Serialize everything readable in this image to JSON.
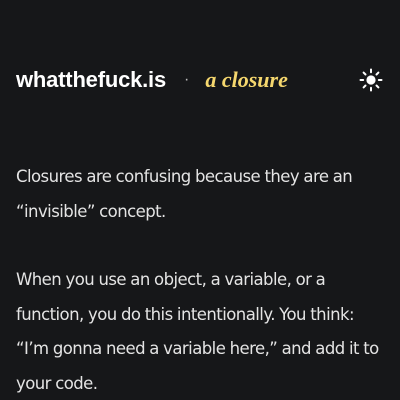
{
  "header": {
    "site_name": "whatthefuck.is",
    "separator": "·",
    "topic": "a closure",
    "theme_toggle_icon": "sun-icon"
  },
  "article": {
    "paragraphs": [
      "Closures are confusing because they are an “invisible” concept.",
      "When you use an object, a variable, or a function, you do this intentionally. You think: “I’m gonna need a variable here,” and add it to your code."
    ]
  },
  "colors": {
    "background": "#161719",
    "text": "#e4e4e4",
    "topic_accent": "#f5d76e"
  }
}
